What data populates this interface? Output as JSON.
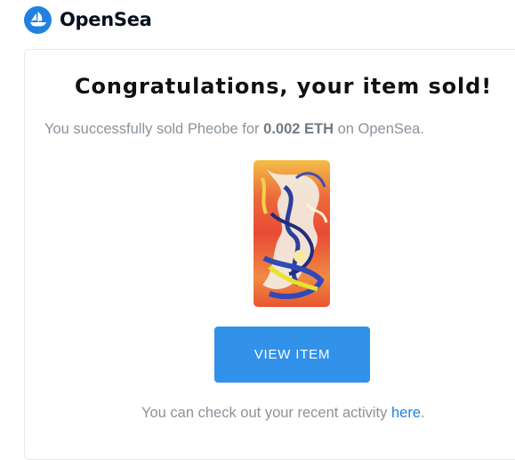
{
  "brand": {
    "name": "OpenSea",
    "logo_icon": "sailboat-icon",
    "color": "#2081e2"
  },
  "email": {
    "headline": "Congratulations, your item sold!",
    "sale": {
      "prefix": "You successfully sold ",
      "item_name": "Pheobe",
      "middle": " for ",
      "price": "0.002 ETH",
      "suffix": " on OpenSea."
    },
    "item_image_alt": "Pheobe NFT artwork (phoenix)",
    "button_label": "VIEW ITEM",
    "button_color": "#3291e9",
    "footer": {
      "text": "You can check out your recent activity ",
      "link_label": "here",
      "end": "."
    }
  }
}
